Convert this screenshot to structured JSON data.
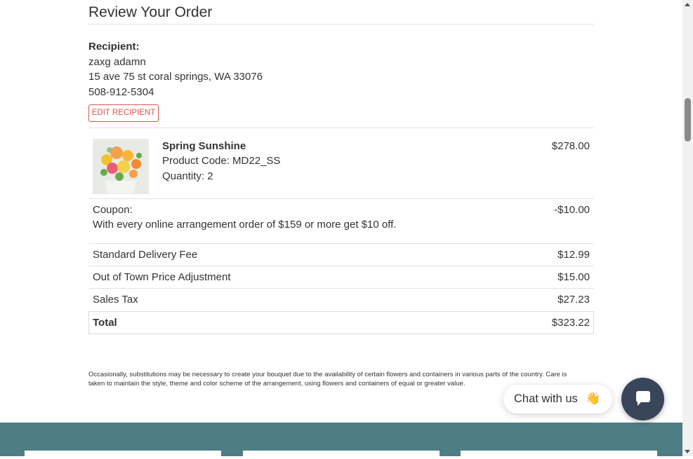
{
  "order": {
    "heading": "Review Your Order",
    "recipient": {
      "label": "Recipient:",
      "name": "zaxg adamn",
      "address": "15 ave 75 st coral springs, WA 33076",
      "phone": "508-912-5304",
      "edit_label": "EDIT RECIPIENT"
    },
    "product": {
      "name": "Spring Sunshine",
      "code": "Product Code: MD22_SS",
      "quantity": "Quantity: 2",
      "price": "$278.00",
      "image_icon": "flower-bouquet-photo"
    },
    "coupon": {
      "label": "Coupon:",
      "description": "With every online arrangement order of $159 or more get $10 off.",
      "amount": "-$10.00"
    },
    "fees": [
      {
        "label": "Standard Delivery Fee",
        "amount": "$12.99"
      },
      {
        "label": "Out of Town Price Adjustment",
        "amount": "$15.00"
      },
      {
        "label": "Sales Tax",
        "amount": "$27.23"
      }
    ],
    "total": {
      "label": "Total",
      "amount": "$323.22"
    }
  },
  "disclaimer": "Occasionally, substitutions may be necessary to create your bouquet due to the availability of certain flowers and containers in various parts of the country. Care is taken to maintain the style, theme and color scheme of the arrangement, using flowers and containers of equal or greater value.",
  "chat": {
    "label": "Chat with us",
    "emoji": "👋",
    "button_icon": "chat-bubble-icon"
  },
  "colors": {
    "footer_bg": "#4e7e84",
    "edit_button": "#d9534f",
    "chat_button": "#394558"
  }
}
